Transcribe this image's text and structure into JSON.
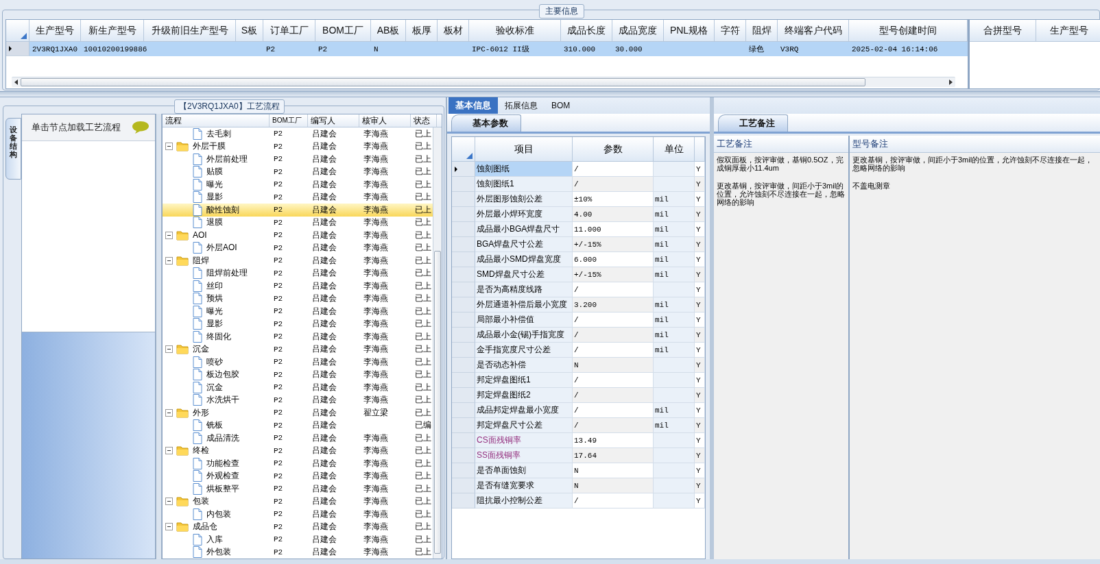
{
  "main_info": {
    "title": "主要信息",
    "columns": [
      "生产型号",
      "新生产型号",
      "升级前旧生产型号",
      "S板",
      "订单工厂",
      "BOM工厂",
      "AB板",
      "板厚",
      "板材",
      "验收标准",
      "成品长度",
      "成品宽度",
      "PNL规格",
      "字符",
      "阻焊",
      "终端客户代码",
      "型号创建时间"
    ],
    "rows": [
      {
        "selected": true,
        "cells": [
          "2V3RQ1JXA0",
          "10010200199886",
          null,
          null,
          "P2",
          "P2",
          "N",
          null,
          null,
          "IPC-6012 II级",
          "310.000",
          "30.000",
          null,
          null,
          "绿色",
          "V3RQ",
          "2025-02-04 16:14:06"
        ]
      }
    ],
    "side_columns": [
      "合拼型号",
      "生产型号"
    ]
  },
  "process": {
    "title": "【2V3RQ1JXA0】工艺流程",
    "side_tab": "设备结构",
    "hint": "单击节点加载工艺流程",
    "columns": [
      "流程",
      "BOM工厂",
      "编写人",
      "核审人",
      "状态"
    ],
    "rows": [
      {
        "kind": "step",
        "label": "去毛刺",
        "factory": "P2",
        "writer": "吕建会",
        "reviewer": "李海燕",
        "status": "已上",
        "selected": false
      },
      {
        "kind": "group",
        "label": "外层干膜",
        "factory": "P2",
        "writer": "吕建会",
        "reviewer": "李海燕",
        "status": "已上",
        "selected": false,
        "expanded": true,
        "children": [
          {
            "kind": "step",
            "label": "外层前处理",
            "factory": "P2",
            "writer": "吕建会",
            "reviewer": "李海燕",
            "status": "已上",
            "selected": false
          },
          {
            "kind": "step",
            "label": "贴膜",
            "factory": "P2",
            "writer": "吕建会",
            "reviewer": "李海燕",
            "status": "已上",
            "selected": false
          },
          {
            "kind": "step",
            "label": "曝光",
            "factory": "P2",
            "writer": "吕建会",
            "reviewer": "李海燕",
            "status": "已上",
            "selected": false
          },
          {
            "kind": "step",
            "label": "显影",
            "factory": "P2",
            "writer": "吕建会",
            "reviewer": "李海燕",
            "status": "已上",
            "selected": false
          },
          {
            "kind": "step",
            "label": "酸性蚀刻",
            "factory": "P2",
            "writer": "吕建会",
            "reviewer": "李海燕",
            "status": "已上",
            "selected": true
          },
          {
            "kind": "step",
            "label": "退膜",
            "factory": "P2",
            "writer": "吕建会",
            "reviewer": "李海燕",
            "status": "已上",
            "selected": false
          }
        ]
      },
      {
        "kind": "group",
        "label": "AOI",
        "factory": "P2",
        "writer": "吕建会",
        "reviewer": "李海燕",
        "status": "已上",
        "selected": false,
        "expanded": true,
        "children": [
          {
            "kind": "step",
            "label": "外层AOI",
            "factory": "P2",
            "writer": "吕建会",
            "reviewer": "李海燕",
            "status": "已上",
            "selected": false
          }
        ]
      },
      {
        "kind": "group",
        "label": "阻焊",
        "factory": "P2",
        "writer": "吕建会",
        "reviewer": "李海燕",
        "status": "已上",
        "selected": false,
        "expanded": true,
        "children": [
          {
            "kind": "step",
            "label": "阻焊前处理",
            "factory": "P2",
            "writer": "吕建会",
            "reviewer": "李海燕",
            "status": "已上",
            "selected": false
          },
          {
            "kind": "step",
            "label": "丝印",
            "factory": "P2",
            "writer": "吕建会",
            "reviewer": "李海燕",
            "status": "已上",
            "selected": false
          },
          {
            "kind": "step",
            "label": "预烘",
            "factory": "P2",
            "writer": "吕建会",
            "reviewer": "李海燕",
            "status": "已上",
            "selected": false
          },
          {
            "kind": "step",
            "label": "曝光",
            "factory": "P2",
            "writer": "吕建会",
            "reviewer": "李海燕",
            "status": "已上",
            "selected": false
          },
          {
            "kind": "step",
            "label": "显影",
            "factory": "P2",
            "writer": "吕建会",
            "reviewer": "李海燕",
            "status": "已上",
            "selected": false
          },
          {
            "kind": "step",
            "label": "终固化",
            "factory": "P2",
            "writer": "吕建会",
            "reviewer": "李海燕",
            "status": "已上",
            "selected": false
          }
        ]
      },
      {
        "kind": "group",
        "label": "沉金",
        "factory": "P2",
        "writer": "吕建会",
        "reviewer": "李海燕",
        "status": "已上",
        "selected": false,
        "expanded": true,
        "children": [
          {
            "kind": "step",
            "label": "喷砂",
            "factory": "P2",
            "writer": "吕建会",
            "reviewer": "李海燕",
            "status": "已上",
            "selected": false
          },
          {
            "kind": "step",
            "label": "板边包胶",
            "factory": "P2",
            "writer": "吕建会",
            "reviewer": "李海燕",
            "status": "已上",
            "selected": false
          },
          {
            "kind": "step",
            "label": "沉金",
            "factory": "P2",
            "writer": "吕建会",
            "reviewer": "李海燕",
            "status": "已上",
            "selected": false
          },
          {
            "kind": "step",
            "label": "水洗烘干",
            "factory": "P2",
            "writer": "吕建会",
            "reviewer": "李海燕",
            "status": "已上",
            "selected": false
          }
        ]
      },
      {
        "kind": "group",
        "label": "外形",
        "factory": "P2",
        "writer": "吕建会",
        "reviewer": "翟立梁",
        "status": "已上",
        "selected": false,
        "expanded": true,
        "children": [
          {
            "kind": "step",
            "label": "铣板",
            "factory": "P2",
            "writer": "吕建会",
            "status": "已编",
            "selected": false
          },
          {
            "kind": "step",
            "label": "成品清洗",
            "factory": "P2",
            "writer": "吕建会",
            "reviewer": "李海燕",
            "status": "已上",
            "selected": false
          }
        ]
      },
      {
        "kind": "group",
        "label": "终检",
        "factory": "P2",
        "writer": "吕建会",
        "reviewer": "李海燕",
        "status": "已上",
        "selected": false,
        "expanded": true,
        "children": [
          {
            "kind": "step",
            "label": "功能检查",
            "factory": "P2",
            "writer": "吕建会",
            "reviewer": "李海燕",
            "status": "已上",
            "selected": false
          },
          {
            "kind": "step",
            "label": "外观检查",
            "factory": "P2",
            "writer": "吕建会",
            "reviewer": "李海燕",
            "status": "已上",
            "selected": false
          },
          {
            "kind": "step",
            "label": "烘板整平",
            "factory": "P2",
            "writer": "吕建会",
            "reviewer": "李海燕",
            "status": "已上",
            "selected": false
          }
        ]
      },
      {
        "kind": "group",
        "label": "包装",
        "factory": "P2",
        "writer": "吕建会",
        "reviewer": "李海燕",
        "status": "已上",
        "selected": false,
        "expanded": true,
        "children": [
          {
            "kind": "step",
            "label": "内包装",
            "factory": "P2",
            "writer": "吕建会",
            "reviewer": "李海燕",
            "status": "已上",
            "selected": false
          }
        ]
      },
      {
        "kind": "group",
        "label": "成品仓",
        "factory": "P2",
        "writer": "吕建会",
        "reviewer": "李海燕",
        "status": "已上",
        "selected": false,
        "expanded": true,
        "children": [
          {
            "kind": "step",
            "label": "入库",
            "factory": "P2",
            "writer": "吕建会",
            "reviewer": "李海燕",
            "status": "已上",
            "selected": false
          },
          {
            "kind": "step",
            "label": "外包装",
            "factory": "P2",
            "writer": "吕建会",
            "reviewer": "李海燕",
            "status": "已上",
            "selected": false
          }
        ]
      }
    ]
  },
  "detail_tabs": [
    {
      "label": "基本信息",
      "selected": true
    },
    {
      "label": "拓展信息",
      "selected": false
    },
    {
      "label": "BOM",
      "selected": false
    }
  ],
  "params": {
    "tab": "基本参数",
    "columns": [
      "项目",
      "参数",
      "单位"
    ],
    "rows": [
      {
        "item": "蚀刻图纸",
        "value": "/",
        "unit": null,
        "flag": "Y",
        "selected": true,
        "flagged": false
      },
      {
        "item": "蚀刻图纸1",
        "value": "/",
        "unit": null,
        "flag": "Y",
        "selected": false,
        "flagged": false
      },
      {
        "item": "外层图形蚀刻公差",
        "value": "±10%",
        "unit": "mil",
        "flag": "Y",
        "selected": false,
        "flagged": false
      },
      {
        "item": "外层最小焊环宽度",
        "value": "4.00",
        "unit": "mil",
        "flag": "Y",
        "selected": false,
        "flagged": false
      },
      {
        "item": "成品最小BGA焊盘尺寸",
        "value": "11.000",
        "unit": "mil",
        "flag": "Y",
        "selected": false,
        "flagged": false
      },
      {
        "item": "BGA焊盘尺寸公差",
        "value": "+/-15%",
        "unit": "mil",
        "flag": "Y",
        "selected": false,
        "flagged": false
      },
      {
        "item": "成品最小SMD焊盘宽度",
        "value": "6.000",
        "unit": "mil",
        "flag": "Y",
        "selected": false,
        "flagged": false
      },
      {
        "item": "SMD焊盘尺寸公差",
        "value": "+/-15%",
        "unit": "mil",
        "flag": "Y",
        "selected": false,
        "flagged": false
      },
      {
        "item": "是否为高精度线路",
        "value": "/",
        "unit": null,
        "flag": "Y",
        "selected": false,
        "flagged": false
      },
      {
        "item": "外层通道补偿后最小宽度",
        "value": "3.200",
        "unit": "mil",
        "flag": "Y",
        "selected": false,
        "flagged": false
      },
      {
        "item": "局部最小补偿值",
        "value": "/",
        "unit": "mil",
        "flag": "Y",
        "selected": false,
        "flagged": false
      },
      {
        "item": "成品最小金(锡)手指宽度",
        "value": "/",
        "unit": "mil",
        "flag": "Y",
        "selected": false,
        "flagged": false
      },
      {
        "item": "金手指宽度尺寸公差",
        "value": "/",
        "unit": "mil",
        "flag": "Y",
        "selected": false,
        "flagged": false
      },
      {
        "item": "是否动态补偿",
        "value": "N",
        "unit": null,
        "flag": "Y",
        "selected": false,
        "flagged": false
      },
      {
        "item": "邦定焊盘图纸1",
        "value": "/",
        "unit": null,
        "flag": "Y",
        "selected": false,
        "flagged": false
      },
      {
        "item": "邦定焊盘图纸2",
        "value": "/",
        "unit": null,
        "flag": "Y",
        "selected": false,
        "flagged": false
      },
      {
        "item": "成品邦定焊盘最小宽度",
        "value": "/",
        "unit": "mil",
        "flag": "Y",
        "selected": false,
        "flagged": false
      },
      {
        "item": "邦定焊盘尺寸公差",
        "value": "/",
        "unit": "mil",
        "flag": "Y",
        "selected": false,
        "flagged": false
      },
      {
        "item": "CS面残铜率",
        "value": "13.49",
        "unit": null,
        "flag": "Y",
        "selected": false,
        "flagged": true
      },
      {
        "item": "SS面残铜率",
        "value": "17.64",
        "unit": null,
        "flag": "Y",
        "selected": false,
        "flagged": true
      },
      {
        "item": "是否单面蚀刻",
        "value": "N",
        "unit": null,
        "flag": "Y",
        "selected": false,
        "flagged": false
      },
      {
        "item": "是否有缝宽要求",
        "value": "N",
        "unit": null,
        "flag": "Y",
        "selected": false,
        "flagged": false
      },
      {
        "item": "阻抗最小控制公差",
        "value": "/",
        "unit": null,
        "flag": "Y",
        "selected": false,
        "flagged": false
      }
    ]
  },
  "notes": {
    "tab": "工艺备注",
    "columns": [
      {
        "title": "工艺备注",
        "paragraphs": [
          "假双面板，按评审做，基铜0.5OZ，完成铜厚最小11.4um",
          "更改基铜，按评审做，间距小于3mil的位置，允许蚀刻不尽连接在一起，忽略网络的影响"
        ]
      },
      {
        "title": "型号备注",
        "paragraphs": [
          "更改基铜，按评审做，间距小于3mil的位置，允许蚀刻不尽连接在一起，忽略网络的影响",
          "不盖电测章"
        ]
      }
    ]
  }
}
